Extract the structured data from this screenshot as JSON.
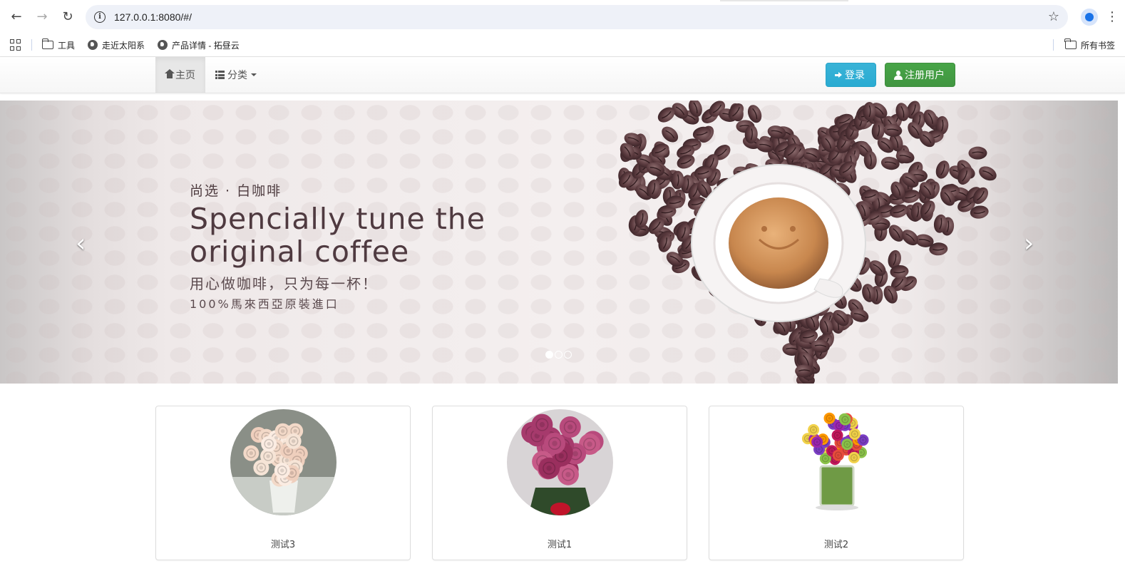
{
  "browser": {
    "url": "127.0.0.1:8080/#/",
    "icons": {
      "back": "arrow-left-icon",
      "forward": "arrow-right-icon",
      "reload": "reload-icon",
      "info": "info-icon",
      "bookmark": "star-icon",
      "profile": "profile-icon",
      "menu": "kebab-menu-icon"
    }
  },
  "bookmarks": {
    "items": [
      {
        "label": "工具",
        "icon": "folder-icon"
      },
      {
        "label": "走近太阳系",
        "icon": "globe-icon"
      },
      {
        "label": "产品详情 - 拓昼云",
        "icon": "globe-icon"
      }
    ],
    "all_bookmarks": "所有书签"
  },
  "navbar": {
    "home": "主页",
    "category": "分类",
    "login": "登录",
    "register": "注册用户"
  },
  "carousel": {
    "subtitle": "尚选 · 白咖啡",
    "title_line1": "Spencially tune the",
    "title_line2": "original coffee",
    "line1": "用心做咖啡，只为每一杯！",
    "line2": "100%馬來西亞原裝進口",
    "prev": "‹",
    "next": "›",
    "active_index": 0,
    "slide_count": 3
  },
  "products": [
    {
      "name": "测试3",
      "image": "white-rose-bouquet"
    },
    {
      "name": "测试1",
      "image": "pink-rose-bouquet"
    },
    {
      "name": "测试2",
      "image": "mixed-flower-vase"
    }
  ]
}
